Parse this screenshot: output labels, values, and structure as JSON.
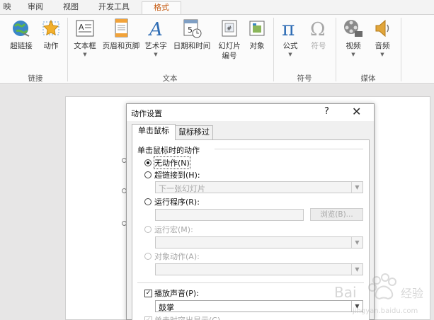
{
  "ribbon_tabs": [
    {
      "label": "映"
    },
    {
      "label": "审阅"
    },
    {
      "label": "视图"
    },
    {
      "label": "开发工具"
    },
    {
      "label": "格式",
      "active": true
    }
  ],
  "ribbon": {
    "groups": [
      {
        "label": "链接",
        "buttons": [
          {
            "label": "超链接",
            "icon": "hyperlink-globe-icon"
          },
          {
            "label": "动作",
            "icon": "action-star-icon"
          }
        ]
      },
      {
        "label": "文本",
        "buttons": [
          {
            "label": "文本框",
            "icon": "textbox-icon"
          },
          {
            "label": "页眉和页脚",
            "icon": "header-footer-icon"
          },
          {
            "label": "艺术字",
            "icon": "wordart-icon"
          },
          {
            "label": "日期和时间",
            "icon": "calendar-clock-icon"
          },
          {
            "label": "幻灯片",
            "label2": "编号",
            "icon": "slide-number-icon"
          },
          {
            "label": "对象",
            "icon": "object-icon"
          }
        ]
      },
      {
        "label": "符号",
        "buttons": [
          {
            "label": "公式",
            "icon": "pi-icon"
          },
          {
            "label": "符号",
            "icon": "omega-icon"
          }
        ]
      },
      {
        "label": "媒体",
        "buttons": [
          {
            "label": "视频",
            "icon": "film-reel-icon"
          },
          {
            "label": "音频",
            "icon": "speaker-icon"
          }
        ]
      }
    ]
  },
  "dialog": {
    "title": "动作设置",
    "help": "?",
    "close": "✕",
    "tabs": [
      {
        "label": "单击鼠标",
        "active": true
      },
      {
        "label": "鼠标移过"
      }
    ],
    "section_title": "单击鼠标时的动作",
    "options": [
      {
        "label": "无动作(N)",
        "checked": true
      },
      {
        "label": "超链接到(H):"
      },
      {
        "label": "运行程序(R):"
      },
      {
        "label": "运行宏(M):",
        "disabled": true
      },
      {
        "label": "对象动作(A):",
        "disabled": true
      }
    ],
    "hyperlink_value": "下一张幻灯片",
    "browse_label": "浏览(B)...",
    "play_sound": {
      "label": "播放声音(P):",
      "checked": true,
      "value": "鼓掌"
    },
    "highlight_click": {
      "label": "单击时突出显示(C)"
    }
  },
  "colors": {
    "active_tab_text": "#c55a11",
    "dialog_bg": "#f0f0f0"
  }
}
